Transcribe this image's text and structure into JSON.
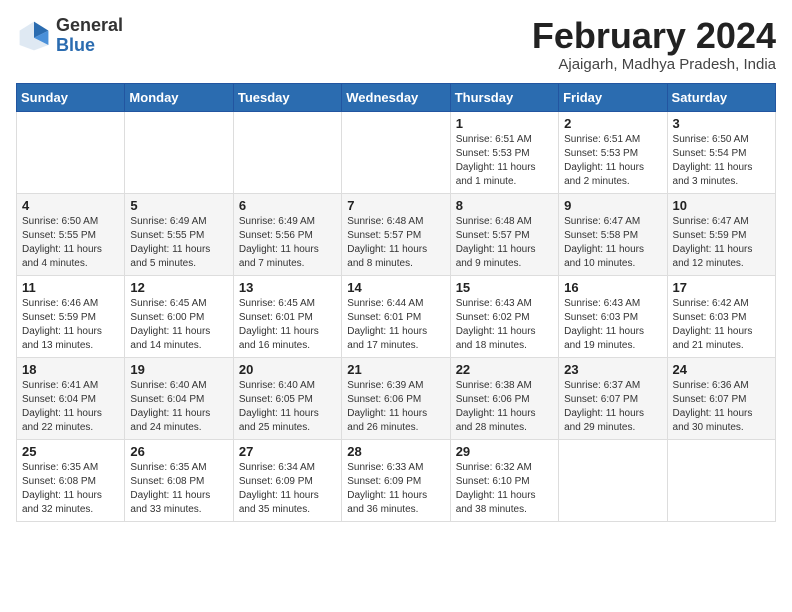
{
  "header": {
    "logo_general": "General",
    "logo_blue": "Blue",
    "title": "February 2024",
    "location": "Ajaigarh, Madhya Pradesh, India"
  },
  "weekdays": [
    "Sunday",
    "Monday",
    "Tuesday",
    "Wednesday",
    "Thursday",
    "Friday",
    "Saturday"
  ],
  "weeks": [
    [
      {
        "day": "",
        "info": ""
      },
      {
        "day": "",
        "info": ""
      },
      {
        "day": "",
        "info": ""
      },
      {
        "day": "",
        "info": ""
      },
      {
        "day": "1",
        "info": "Sunrise: 6:51 AM\nSunset: 5:53 PM\nDaylight: 11 hours and 1 minute."
      },
      {
        "day": "2",
        "info": "Sunrise: 6:51 AM\nSunset: 5:53 PM\nDaylight: 11 hours and 2 minutes."
      },
      {
        "day": "3",
        "info": "Sunrise: 6:50 AM\nSunset: 5:54 PM\nDaylight: 11 hours and 3 minutes."
      }
    ],
    [
      {
        "day": "4",
        "info": "Sunrise: 6:50 AM\nSunset: 5:55 PM\nDaylight: 11 hours and 4 minutes."
      },
      {
        "day": "5",
        "info": "Sunrise: 6:49 AM\nSunset: 5:55 PM\nDaylight: 11 hours and 5 minutes."
      },
      {
        "day": "6",
        "info": "Sunrise: 6:49 AM\nSunset: 5:56 PM\nDaylight: 11 hours and 7 minutes."
      },
      {
        "day": "7",
        "info": "Sunrise: 6:48 AM\nSunset: 5:57 PM\nDaylight: 11 hours and 8 minutes."
      },
      {
        "day": "8",
        "info": "Sunrise: 6:48 AM\nSunset: 5:57 PM\nDaylight: 11 hours and 9 minutes."
      },
      {
        "day": "9",
        "info": "Sunrise: 6:47 AM\nSunset: 5:58 PM\nDaylight: 11 hours and 10 minutes."
      },
      {
        "day": "10",
        "info": "Sunrise: 6:47 AM\nSunset: 5:59 PM\nDaylight: 11 hours and 12 minutes."
      }
    ],
    [
      {
        "day": "11",
        "info": "Sunrise: 6:46 AM\nSunset: 5:59 PM\nDaylight: 11 hours and 13 minutes."
      },
      {
        "day": "12",
        "info": "Sunrise: 6:45 AM\nSunset: 6:00 PM\nDaylight: 11 hours and 14 minutes."
      },
      {
        "day": "13",
        "info": "Sunrise: 6:45 AM\nSunset: 6:01 PM\nDaylight: 11 hours and 16 minutes."
      },
      {
        "day": "14",
        "info": "Sunrise: 6:44 AM\nSunset: 6:01 PM\nDaylight: 11 hours and 17 minutes."
      },
      {
        "day": "15",
        "info": "Sunrise: 6:43 AM\nSunset: 6:02 PM\nDaylight: 11 hours and 18 minutes."
      },
      {
        "day": "16",
        "info": "Sunrise: 6:43 AM\nSunset: 6:03 PM\nDaylight: 11 hours and 19 minutes."
      },
      {
        "day": "17",
        "info": "Sunrise: 6:42 AM\nSunset: 6:03 PM\nDaylight: 11 hours and 21 minutes."
      }
    ],
    [
      {
        "day": "18",
        "info": "Sunrise: 6:41 AM\nSunset: 6:04 PM\nDaylight: 11 hours and 22 minutes."
      },
      {
        "day": "19",
        "info": "Sunrise: 6:40 AM\nSunset: 6:04 PM\nDaylight: 11 hours and 24 minutes."
      },
      {
        "day": "20",
        "info": "Sunrise: 6:40 AM\nSunset: 6:05 PM\nDaylight: 11 hours and 25 minutes."
      },
      {
        "day": "21",
        "info": "Sunrise: 6:39 AM\nSunset: 6:06 PM\nDaylight: 11 hours and 26 minutes."
      },
      {
        "day": "22",
        "info": "Sunrise: 6:38 AM\nSunset: 6:06 PM\nDaylight: 11 hours and 28 minutes."
      },
      {
        "day": "23",
        "info": "Sunrise: 6:37 AM\nSunset: 6:07 PM\nDaylight: 11 hours and 29 minutes."
      },
      {
        "day": "24",
        "info": "Sunrise: 6:36 AM\nSunset: 6:07 PM\nDaylight: 11 hours and 30 minutes."
      }
    ],
    [
      {
        "day": "25",
        "info": "Sunrise: 6:35 AM\nSunset: 6:08 PM\nDaylight: 11 hours and 32 minutes."
      },
      {
        "day": "26",
        "info": "Sunrise: 6:35 AM\nSunset: 6:08 PM\nDaylight: 11 hours and 33 minutes."
      },
      {
        "day": "27",
        "info": "Sunrise: 6:34 AM\nSunset: 6:09 PM\nDaylight: 11 hours and 35 minutes."
      },
      {
        "day": "28",
        "info": "Sunrise: 6:33 AM\nSunset: 6:09 PM\nDaylight: 11 hours and 36 minutes."
      },
      {
        "day": "29",
        "info": "Sunrise: 6:32 AM\nSunset: 6:10 PM\nDaylight: 11 hours and 38 minutes."
      },
      {
        "day": "",
        "info": ""
      },
      {
        "day": "",
        "info": ""
      }
    ]
  ]
}
